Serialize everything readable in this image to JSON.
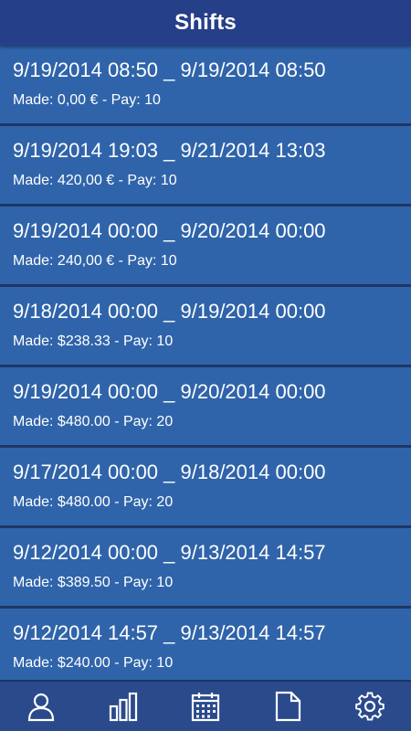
{
  "header": {
    "title": "Shifts"
  },
  "shifts": [
    {
      "range": "9/19/2014 08:50 _ 9/19/2014 08:50",
      "made": "Made: 0,00 € - Pay: 10"
    },
    {
      "range": "9/19/2014 19:03 _ 9/21/2014 13:03",
      "made": "Made: 420,00 € - Pay: 10"
    },
    {
      "range": "9/19/2014 00:00 _ 9/20/2014 00:00",
      "made": "Made: 240,00 € - Pay: 10"
    },
    {
      "range": "9/18/2014 00:00 _ 9/19/2014 00:00",
      "made": "Made: $238.33 - Pay: 10"
    },
    {
      "range": "9/19/2014 00:00 _ 9/20/2014 00:00",
      "made": "Made: $480.00 - Pay: 20"
    },
    {
      "range": "9/17/2014 00:00 _ 9/18/2014 00:00",
      "made": "Made: $480.00 - Pay: 20"
    },
    {
      "range": "9/12/2014 00:00 _ 9/13/2014 14:57",
      "made": "Made: $389.50 - Pay: 10"
    },
    {
      "range": "9/12/2014 14:57 _ 9/13/2014 14:57",
      "made": "Made: $240.00 - Pay: 10"
    }
  ],
  "nav": {
    "items": [
      {
        "icon": "user-icon"
      },
      {
        "icon": "bar-chart-icon"
      },
      {
        "icon": "calendar-icon"
      },
      {
        "icon": "document-icon"
      },
      {
        "icon": "gear-icon"
      }
    ]
  },
  "colors": {
    "header_bg": "#253f88",
    "item_bg": "#3064aa",
    "separator": "#1d3766",
    "nav_bg": "#2a4a8c",
    "text": "#ffffff"
  }
}
